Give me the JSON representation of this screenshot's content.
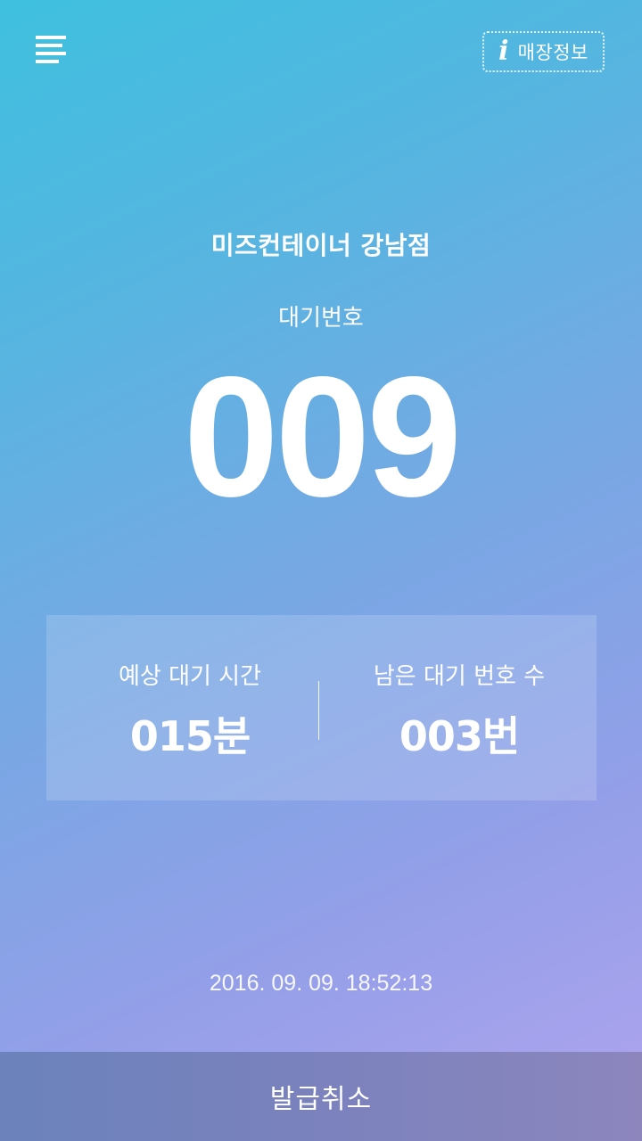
{
  "header": {
    "menu_icon": "menu-lines-icon",
    "store_info": {
      "icon": "info-icon",
      "icon_glyph": "i",
      "label": "매장정보"
    }
  },
  "store": {
    "name": "미즈컨테이너 강남점"
  },
  "ticket": {
    "label": "대기번호",
    "number": "009"
  },
  "stats": {
    "expected_wait": {
      "label": "예상 대기 시간",
      "value": "015분"
    },
    "remaining": {
      "label": "남은 대기 번호 수",
      "value": "003번"
    }
  },
  "timestamp": "2016. 09. 09. 18:52:13",
  "footer": {
    "cancel_label": "발급취소"
  },
  "colors": {
    "gradient_start": "#3fc0df",
    "gradient_end": "#b0a4ee",
    "footer_bar": "#7b82bd",
    "text": "#ffffff"
  }
}
